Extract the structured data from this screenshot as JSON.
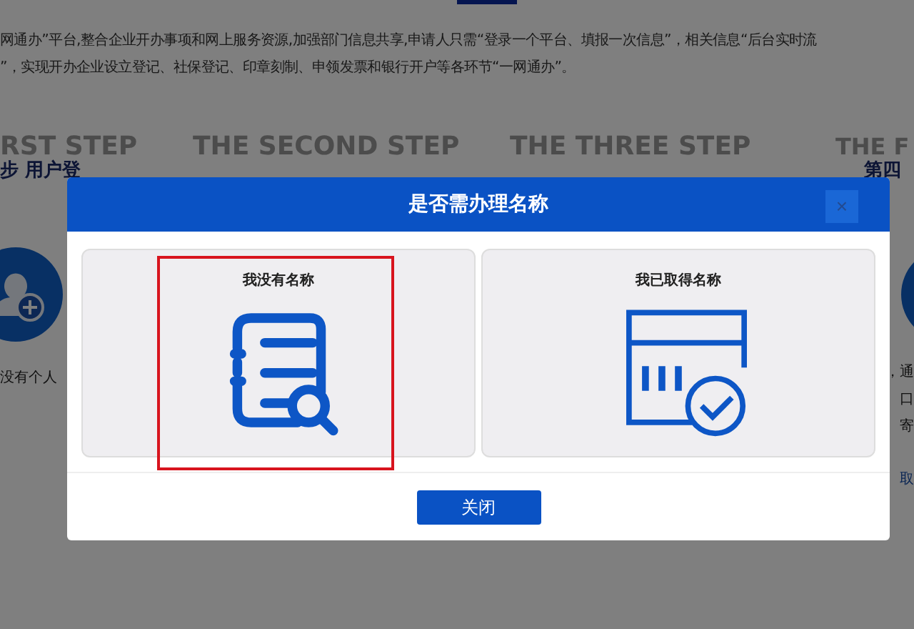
{
  "intro": [
    "网通办”平台,整合企业开办事项和网上服务资源,加强部门信息共享,申请人只需“登录一个平台、填报一次信息”，相关信息“后台实时流",
    "”，实现开办企业设立登记、社保登记、印章刻制、申领发票和银行开户等各环节“一网通办”。"
  ],
  "steps": [
    {
      "title_en": "RST STEP",
      "title_cn": "步 用户登"
    },
    {
      "title_en": "THE SECOND STEP"
    },
    {
      "title_en": "THE THREE STEP"
    },
    {
      "title_en": "THE F",
      "title_cn": "第四"
    }
  ],
  "left_text": "没有个人",
  "right_texts": [
    "，通",
    "口",
    "寄",
    "取"
  ],
  "modal": {
    "title": "是否需办理名称",
    "close": "×",
    "options": [
      {
        "label": "我没有名称",
        "kind": "document",
        "highlighted": true
      },
      {
        "label": "我已取得名称",
        "kind": "calendar",
        "highlighted": false
      }
    ],
    "button": "关闭"
  }
}
